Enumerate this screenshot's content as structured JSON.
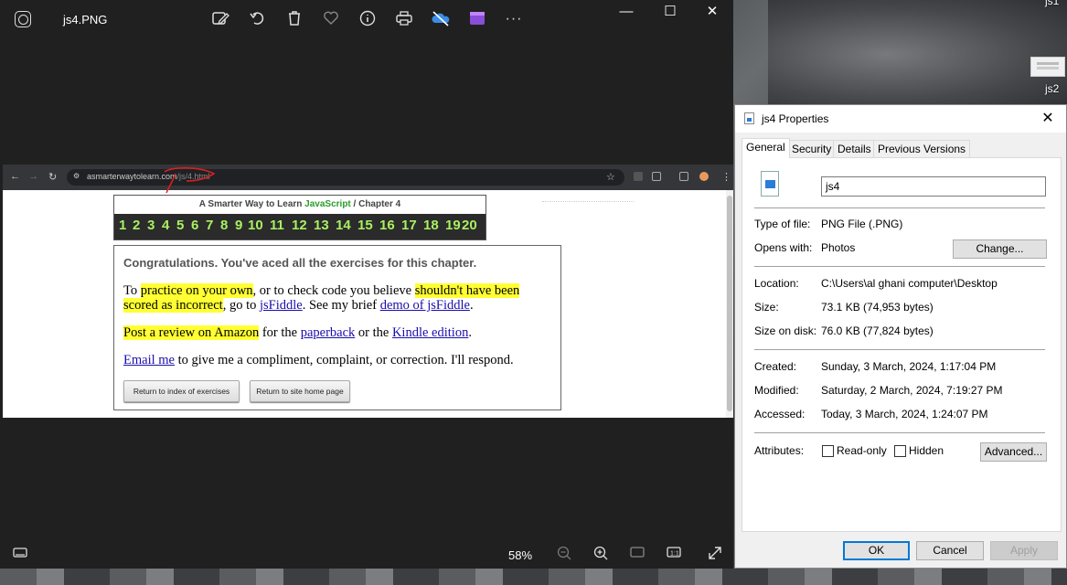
{
  "desktop": {
    "labels": [
      "js1",
      "js2"
    ]
  },
  "photos": {
    "title": "js4.PNG",
    "toolbar_icons": [
      "edit-image-icon",
      "rotate-icon",
      "delete-icon",
      "favorite-icon",
      "info-icon",
      "print-icon",
      "onedrive-icon",
      "clipchamp-icon",
      "more-icon"
    ],
    "window_controls": {
      "minimize": "—",
      "maximize": "☐",
      "close": "✕"
    },
    "more_label": "···",
    "zoom": "58%"
  },
  "shot": {
    "url_host": "asmarterwaytolearn.com",
    "url_path": "/js/4.html",
    "chapter_prefix": "A Smarter Way to Learn",
    "chapter_js": "JavaScript",
    "chapter_suffix": "/  Chapter 4",
    "numbers": [
      "1",
      "2",
      "3",
      "4",
      "5",
      "6",
      "7",
      "8",
      "9",
      "10",
      "11",
      "12",
      "13",
      "14",
      "15",
      "16",
      "17",
      "18",
      "19",
      "20"
    ],
    "congrats": "Congratulations. You've aced all the exercises for this chapter.",
    "p1_a": "To ",
    "p1_hl1": "practice on your own",
    "p1_b": ", or to check code you believe ",
    "p1_hl2": "shouldn't have been scored as incorrect",
    "p1_c": ", go to ",
    "p1_link1": "jsFiddle",
    "p1_d": ". See my brief ",
    "p1_link2": "demo of jsFiddle",
    "p1_e": ".",
    "p2_hl": "Post a review on Amazon",
    "p2_a": " for the ",
    "p2_link1": "paperback",
    "p2_b": " or the ",
    "p2_link2": "Kindle edition",
    "p2_c": ".",
    "p3_link": "Email me",
    "p3_a": " to give me a compliment, complaint, or correction. I'll respond.",
    "btn_index": "Return to index of exercises",
    "btn_home": "Return to site home page"
  },
  "props": {
    "title": "js4 Properties",
    "close": "✕",
    "tabs": [
      "General",
      "Security",
      "Details",
      "Previous Versions"
    ],
    "filename": "js4",
    "type_label": "Type of file:",
    "type_value": "PNG File (.PNG)",
    "opens_label": "Opens with:",
    "opens_value": "Photos",
    "change_btn": "Change...",
    "location_label": "Location:",
    "location_value": "C:\\Users\\al ghani computer\\Desktop",
    "size_label": "Size:",
    "size_value": "73.1 KB (74,953 bytes)",
    "disk_label": "Size on disk:",
    "disk_value": "76.0 KB (77,824 bytes)",
    "created_label": "Created:",
    "created_value": "Sunday, 3 March, 2024, 1:17:04 PM",
    "modified_label": "Modified:",
    "modified_value": "Saturday, 2 March, 2024, 7:19:27 PM",
    "accessed_label": "Accessed:",
    "accessed_value": "Today, 3 March, 2024, 1:24:07 PM",
    "attributes_label": "Attributes:",
    "readonly_label": "Read-only",
    "hidden_label": "Hidden",
    "advanced_btn": "Advanced...",
    "ok_btn": "OK",
    "cancel_btn": "Cancel",
    "apply_btn": "Apply"
  }
}
